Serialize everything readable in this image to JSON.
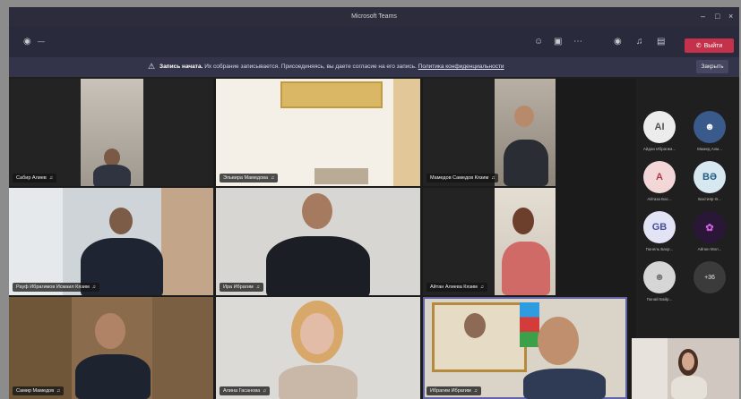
{
  "window": {
    "title": "Microsoft Teams"
  },
  "toolbar": {
    "timer": "—",
    "leave_label": "Выйти"
  },
  "notice": {
    "bold": "Запись начата.",
    "text": "Их собрание записывается. Присоединяясь, вы даете согласие на его запись.",
    "link": "Политика конфиденциальности",
    "dismiss_label": "Закрыть"
  },
  "participants": [
    {
      "name": "Сабир Алиев"
    },
    {
      "name": "Эльвира Мамедова"
    },
    {
      "name": "Мамедов Самедов Кязим"
    },
    {
      "name": "Рауф Ибрагимов Исмаил Кязим"
    },
    {
      "name": "Ира Ибрагим"
    },
    {
      "name": "Айтан Алиева Кязим"
    },
    {
      "name": "Самир Мамедов"
    },
    {
      "name": "Алина Гасанова"
    },
    {
      "name": "Ибрагим Ибрагим"
    }
  ],
  "roster": [
    {
      "initials": "AI",
      "label": "Айдан Ибрагим..."
    },
    {
      "initials": "",
      "label": "Мамед Ахм..."
    },
    {
      "initials": "A",
      "label": "Айтаза Бас..."
    },
    {
      "initials": "BƏ",
      "label": "Бахтияр Ə..."
    },
    {
      "initials": "GB",
      "label": "Гюнель Бахр..."
    },
    {
      "initials": "",
      "label": "Айгюн Мол..."
    },
    {
      "initials": "",
      "label": "Гюнай Байр..."
    }
  ],
  "overflow_count": "+36",
  "colors": {
    "leave": "#c4314b",
    "titlebar": "#2d2c3c",
    "toolbar": "#292a3b"
  }
}
